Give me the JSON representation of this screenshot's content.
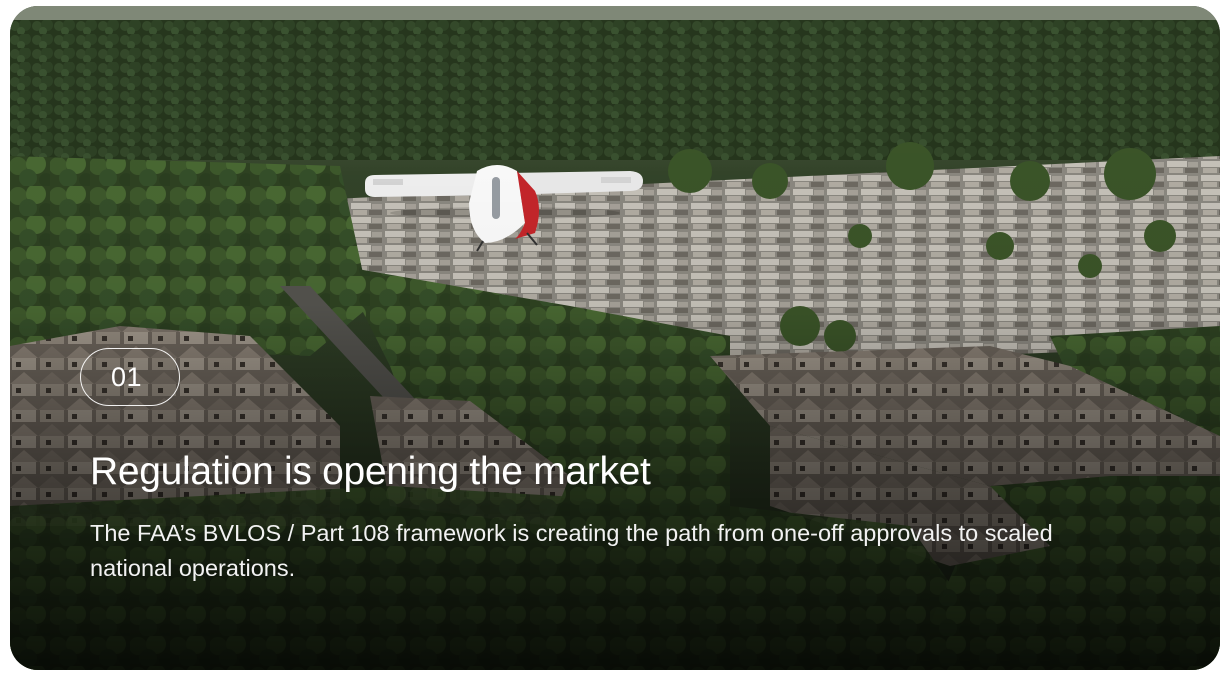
{
  "card": {
    "number": "01",
    "title": "Regulation is opening the market",
    "description": "The FAA’s BVLOS / Part 108 framework is creating the path from one-off approvals to scaled national operations.",
    "image": {
      "depicts": "aerial suburban neighborhood with delivery drone",
      "drone_color": "#ffffff",
      "drone_accent": "#c8262b"
    }
  },
  "colors": {
    "text": "#ffffff",
    "foliage": "#3f5a2c",
    "rooftops": "#a7a29a"
  }
}
